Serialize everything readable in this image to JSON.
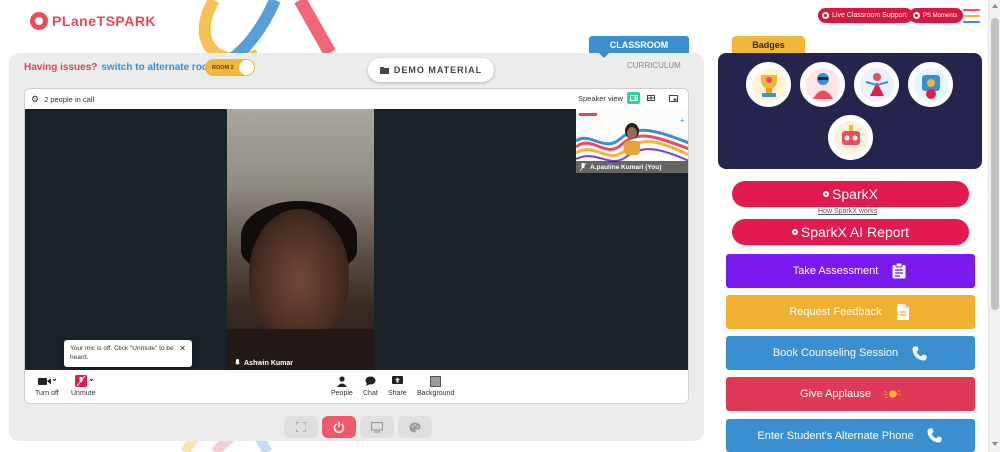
{
  "header": {
    "logo_text": "PLaneTSPARK",
    "live_support_label": "Live Classroom Support",
    "ps_moments_label": "PS Moments",
    "menu_colors": [
      "#ef4b5f",
      "#f0b73a",
      "#3a8fd0"
    ]
  },
  "classroom": {
    "issues_text": "Having issues?",
    "switch_text": "switch to alternate room",
    "room_toggle_label": "ROOM 2",
    "demo_material_label": "DEMO MATERIAL",
    "classroom_tab_label": "CLASSROOM",
    "curriculum_label": "CURRICULUM"
  },
  "call": {
    "people_in_call": "2 people in call",
    "speaker_view_label": "Speaker view",
    "main_participant": "Ashwin Kumar",
    "self_participant": "A.pauline Kumari (You)",
    "mic_tooltip": "Your mic is off. Click \"Unmute\" to be heard.",
    "controls": {
      "turn_off": "Turn off",
      "unmute": "Unmute",
      "people": "People",
      "chat": "Chat",
      "share": "Share",
      "background": "Background"
    },
    "accent_color": "#2bd4a4"
  },
  "badges": {
    "tab_label": "Badges",
    "items": [
      "trophy-badge",
      "superhero-badge",
      "dancer-badge",
      "achiever-badge",
      "robot-badge"
    ]
  },
  "sparkx": {
    "sparkx_label": "SparkX",
    "how_label": "How SparkX works",
    "ai_report_label": "SparkX AI Report",
    "color": "#e31a4d"
  },
  "actions": [
    {
      "label": "Take Assessment",
      "icon": "clipboard-icon",
      "color": "#7a18f0"
    },
    {
      "label": "Request Feedback",
      "icon": "document-icon",
      "color": "#f0b132"
    },
    {
      "label": "Book Counseling Session",
      "icon": "phone-icon",
      "color": "#3a8fd0"
    },
    {
      "label": "Give Applause",
      "icon": "clap-icon",
      "color": "#de3a57"
    },
    {
      "label": "Enter Student's Alternate Phone",
      "icon": "phone-icon",
      "color": "#3a8fd0"
    }
  ]
}
